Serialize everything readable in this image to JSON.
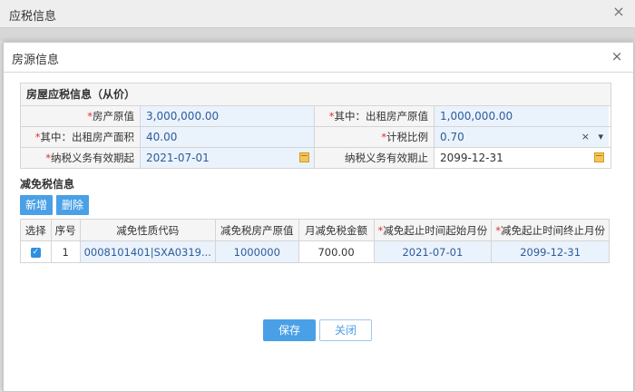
{
  "outer": {
    "title": "应税信息",
    "close_icon": "×"
  },
  "dialog": {
    "title": "房源信息",
    "close_icon": "×"
  },
  "form": {
    "section_title": "房屋应税信息（从价）",
    "rows": [
      {
        "l1": "房产原值",
        "v1": "3,000,000.00",
        "l2": "其中：出租房产原值",
        "v2": "1,000,000.00"
      },
      {
        "l1": "其中：出租房产面积",
        "v1": "40.00",
        "l2": "计税比例",
        "v2": "0.70"
      },
      {
        "l1": "纳税义务有效期起",
        "v1": "2021-07-01",
        "l2": "纳税义务有效期止",
        "v2": "2099-12-31"
      }
    ],
    "select_clear": "×",
    "select_arrow": "▾"
  },
  "deduction": {
    "title": "减免税信息",
    "add_label": "新增",
    "delete_label": "删除",
    "columns": [
      "选择",
      "序号",
      "减免性质代码",
      "减免税房产原值",
      "月减免税金额",
      "减免起止时间起始月份",
      "减免起止时间终止月份"
    ],
    "rows": [
      {
        "checked": "✓",
        "index": "1",
        "code": "0008101401|SXA0319...",
        "value": "1000000",
        "monthly": "700.00",
        "start": "2021-07-01",
        "end": "2099-12-31"
      }
    ]
  },
  "actions": {
    "save_label": "保存",
    "close_label": "关闭"
  },
  "colors": {
    "accent": "#4aa0e6",
    "required": "#e03030",
    "field_bg": "#eaf2fc"
  }
}
